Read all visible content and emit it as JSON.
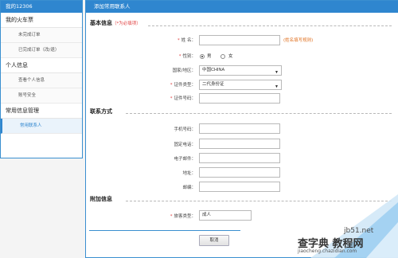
{
  "sidebar": {
    "header": "我的12306",
    "groups": [
      {
        "label": "我的火车票",
        "items": [
          "未完成订单",
          "已完成订单（改/退）"
        ]
      },
      {
        "label": "个人信息",
        "items": [
          "查看个人信息",
          "账号安全"
        ]
      },
      {
        "label": "常用信息管理",
        "items": [
          "常用联系人"
        ]
      }
    ]
  },
  "main": {
    "header": "添加常用联系人",
    "basic": {
      "title": "基本信息",
      "required_note": "（*为必填项）",
      "name_label": "姓  名：",
      "name_hint": "(姓名填写规则)",
      "gender_label": "性别：",
      "gender_male": "男",
      "gender_female": "女",
      "country_label": "国家/地区：",
      "country_value": "中国CHINA",
      "id_type_label": "证件类型：",
      "id_type_value": "二代身份证",
      "id_number_label": "证件号码："
    },
    "contact": {
      "title": "联系方式",
      "mobile_label": "手机号码：",
      "phone_label": "固定电话：",
      "email_label": "电子邮件：",
      "address_label": "地址：",
      "zip_label": "邮编："
    },
    "extra": {
      "title": "附加信息",
      "passenger_type_label": "旅客类型：",
      "passenger_type_value": "成人"
    },
    "cancel_button": "取消"
  },
  "watermark": {
    "line1": "jb51.net",
    "line2": "查字典 教程网",
    "line3": "jiaocheng.chazidian.com"
  },
  "colors": {
    "accent": "#2f86cf",
    "required": "#e04040",
    "hint": "#e07020"
  }
}
